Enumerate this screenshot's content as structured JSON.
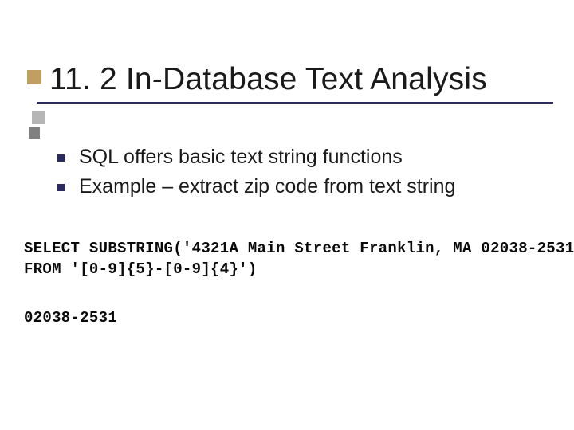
{
  "title": "11. 2 In-Database Text Analysis",
  "bullets": [
    "SQL offers basic text string functions",
    "Example – extract zip code from text string"
  ],
  "code": {
    "line1": "SELECT SUBSTRING('4321A Main Street Franklin, MA 02038-2531'",
    "line2": "FROM '[0-9]{5}-[0-9]{4}')"
  },
  "result": "02038-2531"
}
